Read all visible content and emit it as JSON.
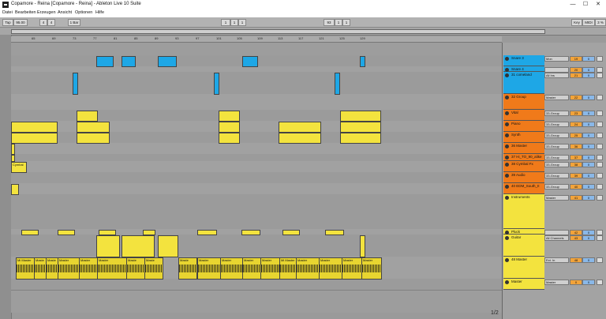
{
  "window": {
    "title": "Copamore - Reina  [Copamore - Reina] - Ableton Live 10 Suite",
    "minimize": "—",
    "maximize": "☐",
    "close": "✕"
  },
  "menu": [
    "Datei",
    "Bearbeiten",
    "Erzeugen",
    "Ansicht",
    "Optionen",
    "Hilfe"
  ],
  "transport": {
    "tap": "Tap",
    "tempo": "95.00",
    "sig_num": "4",
    "sig_den": "4",
    "quant": "1 Bar",
    "pos1": "1",
    "pos2": "1",
    "pos3": "1",
    "loop1": "93",
    "loop2": "1",
    "loop3": "1",
    "key": "Key",
    "midi": "MIDI",
    "cpu": "3 %"
  },
  "ruler": [
    "65",
    "69",
    "73",
    "77",
    "81",
    "85",
    "89",
    "93",
    "97",
    "101",
    "105",
    "109",
    "113",
    "117",
    "121",
    "125",
    "129"
  ],
  "tracks": [
    {
      "name": "Snare 3",
      "color": "#1ea7e6",
      "io": "Mon",
      "v1": "19",
      "v2": "0"
    },
    {
      "name": "Snare 4",
      "color": "#1ea7e6",
      "io": "",
      "v1": "20",
      "v2": "0"
    },
    {
      "name": "31 comeland",
      "color": "#1ea7e6",
      "io": "All Ins",
      "v1": "21",
      "v2": "0"
    },
    {
      "name": "32 Group",
      "color": "#f07a1a",
      "io": "Master",
      "v1": "22",
      "v2": "0"
    },
    {
      "name": "Vital",
      "color": "#f07a1a",
      "io": "33-Group",
      "v1": "23",
      "v2": "0"
    },
    {
      "name": "Piano",
      "color": "#f07a1a",
      "io": "33-Group",
      "v1": "24",
      "v2": "0"
    },
    {
      "name": "Synth",
      "color": "#f07a1a",
      "io": "33-Group",
      "v1": "25",
      "v2": "0"
    },
    {
      "name": "36 Master",
      "color": "#f07a1a",
      "io": "33-Group",
      "v1": "36",
      "v2": "0"
    },
    {
      "name": "37 Hi_TO_90_alike",
      "color": "#f07a1a",
      "io": "33-Group",
      "v1": "37",
      "v2": "0"
    },
    {
      "name": "38 Cymbal Fx",
      "color": "#f07a1a",
      "io": "33-Group",
      "v1": "38",
      "v2": "0"
    },
    {
      "name": "39 Audio",
      "color": "#f07a1a",
      "io": "33-Group",
      "v1": "39",
      "v2": "0"
    },
    {
      "name": "40 EDM_South_II",
      "color": "#f07a1a",
      "io": "33-Group",
      "v1": "40",
      "v2": "0"
    },
    {
      "name": "Instruments",
      "color": "#f3e33e",
      "io": "Master",
      "v1": "41",
      "v2": "0"
    },
    {
      "name": "Pluck",
      "color": "#f3e33e",
      "io": "",
      "v1": "42",
      "v2": "0"
    },
    {
      "name": "Guitar",
      "color": "#f3e33e",
      "io": "All Channels",
      "v1": "43",
      "v2": "0"
    },
    {
      "name": "48 Master",
      "color": "#f3e33e",
      "io": "Ext. In",
      "v1": "48",
      "v2": "0"
    },
    {
      "name": "Master",
      "color": "#f3e33e",
      "io": "Master",
      "v1": "0",
      "v2": "0"
    }
  ],
  "clips": {
    "cymbal": "Cymbal",
    "master": "Master",
    "master_short": "Mi Master",
    "mastr": "Maste"
  },
  "pager": "1/2"
}
